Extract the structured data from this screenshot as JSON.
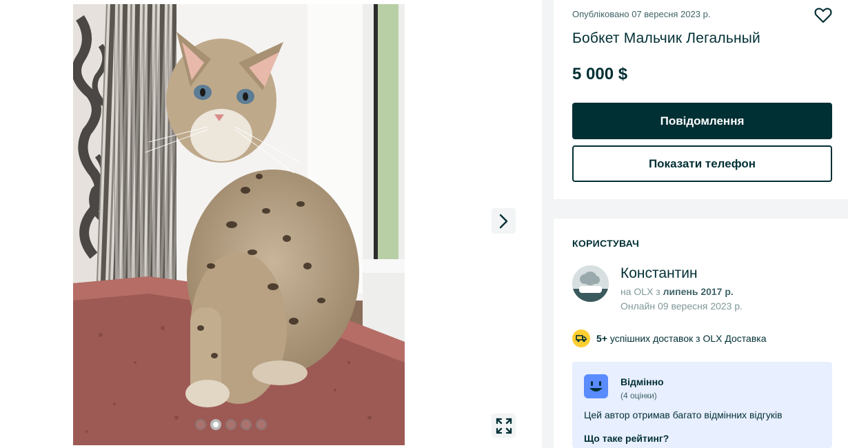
{
  "gallery": {
    "image_alt": "Bobcat kitten sitting on a windowsill",
    "total_slides": 5,
    "active_slide_index": 1,
    "next_icon": "chevron-right-icon",
    "expand_icon": "fullscreen-expand-icon"
  },
  "listing": {
    "posted": "Опубліковано 07 вересня 2023 р.",
    "favorite_icon": "heart-outline-icon",
    "title": "Бобкет Мальчик Легальный",
    "price": "5 000 $",
    "message_button": "Повідомлення",
    "phone_button": "Показати телефон"
  },
  "user": {
    "section_title": "КОРИСТУВАЧ",
    "name": "Константин",
    "since_prefix": "на OLX з ",
    "since_value": "липень 2017 р.",
    "online": "Онлайн 09 вересня 2023 р.",
    "delivery_count": "5+",
    "delivery_text": " успішних доставок з OLX Доставка"
  },
  "rating": {
    "label": "Відмінно",
    "count": "(4 оцінки)",
    "description": "Цей автор отримав багато відмінних відгуків",
    "link": "Що таке рейтинг?"
  },
  "colors": {
    "primary": "#002f34",
    "delivery_badge": "#ffce32",
    "rating_bg": "#e8efff",
    "rating_face": "#5a8cff"
  }
}
